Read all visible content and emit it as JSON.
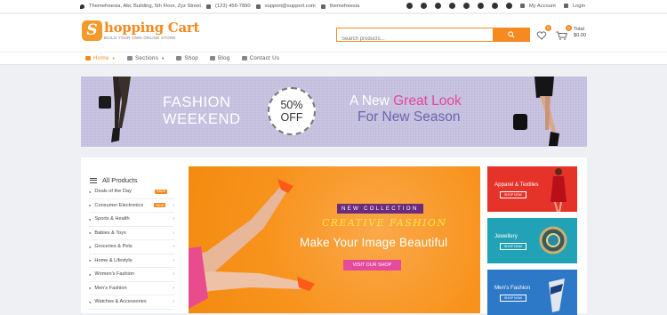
{
  "topbar": {
    "address": "Themefreesia, Abc Building, 5th Floor, Zyz Street",
    "phone": "(123) 456-7890",
    "email": "support@support.com",
    "skype": "themefreesia",
    "social_icons": [
      "facebook-icon",
      "twitter-icon",
      "google-plus-icon",
      "pinterest-icon",
      "youtube-icon",
      "instagram-icon",
      "flickr-icon",
      "linkedin-icon"
    ],
    "my_account": "My Account",
    "login": "Login"
  },
  "header": {
    "logo_letter": "S",
    "logo_title": "hopping Cart",
    "logo_tagline": "BUILD YOUR OWN ONLINE STORE",
    "search_placeholder": "Search products...",
    "wishlist_count": "0",
    "cart_count": "0",
    "total_label": "Total",
    "total_value": "$0.00"
  },
  "nav": {
    "items": [
      {
        "label": "Home",
        "active": true
      },
      {
        "label": "Sections",
        "active": false
      },
      {
        "label": "Shop",
        "active": false
      },
      {
        "label": "Blog",
        "active": false
      },
      {
        "label": "Contact Us",
        "active": false
      }
    ]
  },
  "banner": {
    "line1": "FASHION",
    "line2": "WEEKEND",
    "percent": "50%",
    "off": "OFF",
    "headline_a": "A New ",
    "headline_b": "Great Look",
    "headline_c": "For New Season"
  },
  "sidebar": {
    "title": "All Products",
    "categories": [
      {
        "label": "Deals of the Day",
        "tag": "SALE",
        "arrow": ""
      },
      {
        "label": "Consumer Electronics",
        "tag": "NEW",
        "arrow": "›"
      },
      {
        "label": "Sports & Health",
        "tag": "",
        "arrow": "›"
      },
      {
        "label": "Babies & Toys",
        "tag": "",
        "arrow": "›"
      },
      {
        "label": "Groceries & Pets",
        "tag": "",
        "arrow": "›"
      },
      {
        "label": "Home & Lifestyle",
        "tag": "",
        "arrow": "›"
      },
      {
        "label": "Women's Fashion",
        "tag": "",
        "arrow": "›"
      },
      {
        "label": "Men's Fashion",
        "tag": "",
        "arrow": "›"
      },
      {
        "label": "Watches & Accessories",
        "tag": "",
        "arrow": "›"
      }
    ]
  },
  "hero": {
    "new_collection": "NEW COLLECTION",
    "creative": "CREATIVE FASHION",
    "subtitle": "Make Your Image Beautiful",
    "button": "VISIT OUR SHOP"
  },
  "promos": [
    {
      "title": "Apparel & Textiles",
      "button": "SHOP NOW",
      "color": "#e23a2e"
    },
    {
      "title": "Jewellery",
      "button": "SHOP NOW",
      "color": "#26a6b8"
    },
    {
      "title": "Men's Fashion",
      "button": "SHOP NOW",
      "color": "#2f7ccc"
    }
  ]
}
